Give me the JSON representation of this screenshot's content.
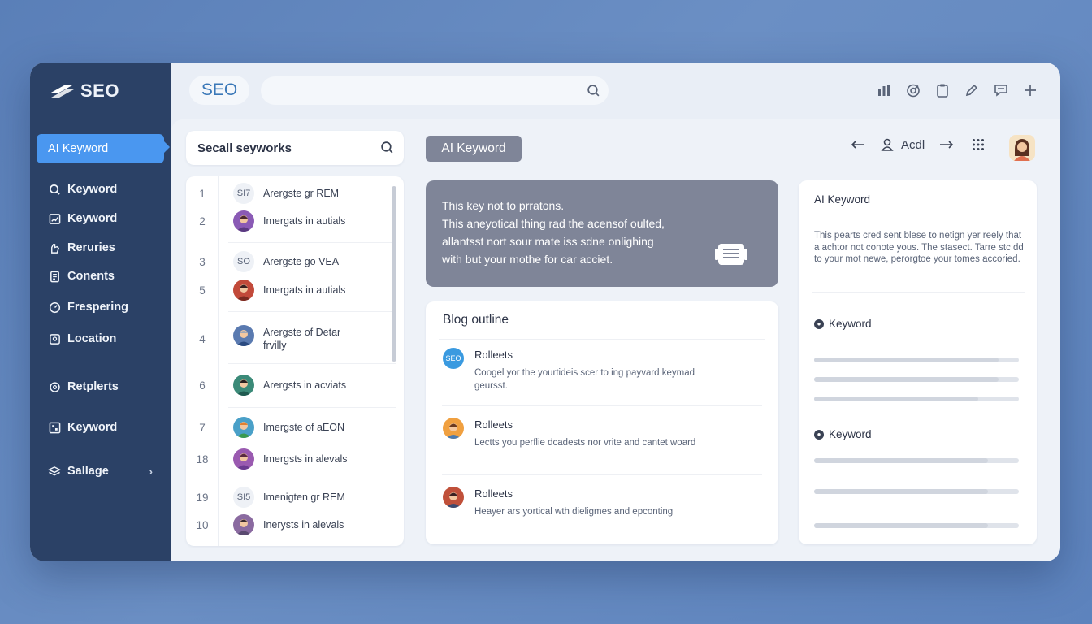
{
  "sidebar": {
    "brand": "SEO",
    "items": [
      {
        "label": "AI Keyword",
        "icon": "sparkle-icon",
        "active": true
      },
      {
        "label": "Keyword",
        "icon": "search-icon"
      },
      {
        "label": "Keyword",
        "icon": "chart-icon"
      },
      {
        "label": "Reruries",
        "icon": "hand-icon"
      },
      {
        "label": "Conents",
        "icon": "document-icon"
      },
      {
        "label": "Frespering",
        "icon": "gauge-icon"
      },
      {
        "label": "Location",
        "icon": "location-icon"
      },
      {
        "label": "Retplerts",
        "icon": "settings-icon"
      },
      {
        "label": "Keyword",
        "icon": "grid-icon"
      },
      {
        "label": "Sallage",
        "icon": "layers-icon",
        "chevron": "›"
      }
    ]
  },
  "topbar": {
    "pill": "SEO",
    "search_placeholder": "",
    "tools": [
      "bar-chart-icon",
      "target-icon",
      "clipboard-icon",
      "pencil-icon",
      "comment-icon",
      "plus-icon"
    ]
  },
  "keyword_search": {
    "label": "Secall seyworks"
  },
  "keywords": [
    {
      "num": "1",
      "avatar_text": "SI7",
      "label": "Arergste gr REM"
    },
    {
      "num": "2",
      "avatar_color": "#8a5ab5",
      "label": "Imergats in autials"
    },
    {
      "num": "3",
      "avatar_text": "SO",
      "label": "Arergste go VEA"
    },
    {
      "num": "5",
      "avatar_color": "#c24a3a",
      "label": "Imergats in autials"
    },
    {
      "num": "4",
      "avatar_color": "#5a7ab0",
      "label": "Arergste of Detar frvilly"
    },
    {
      "num": "6",
      "avatar_color": "#3b8a78",
      "label": "Arergsts in acviats"
    },
    {
      "num": "7",
      "avatar_color": "#4aa0c8",
      "label": "Imergste of aEON"
    },
    {
      "num": "18",
      "avatar_color": "#9a5ab0",
      "label": "Imergsts in alevals"
    },
    {
      "num": "19",
      "avatar_text": "SI5",
      "label": "Imenigten gr REM"
    },
    {
      "num": "10",
      "avatar_color": "#8a6aa0",
      "label": "Inerysts in alevals"
    }
  ],
  "middle": {
    "chip": "AI Keyword",
    "nav_label": "Acdl",
    "info_lines": [
      "This key not to prratons.",
      "This aneyotical thing rad the acensof oulted,",
      "allantsst nort sour mate iss sdne onlighing",
      "with but your mothe for car acciet."
    ],
    "outline": {
      "title": "Blog outline",
      "items": [
        {
          "avatar": "SEO",
          "title": "Rolleets",
          "desc": "Coogel yor the yourtideis scer to ing payvard keymad geursst."
        },
        {
          "avatar_color": "#f0a040",
          "title": "Rolleets",
          "desc": "Lectts you perflie dcadests nor vrite and cantet woard"
        },
        {
          "avatar_color": "#c0503a",
          "title": "Rolleets",
          "desc": "Heayer ars yortical wth dieligmes and epconting"
        }
      ]
    }
  },
  "right": {
    "title": "AI Keyword",
    "desc": "This pearts cred sent blese to netign yer reely that a achtor not conote yous. The stasect. Tarre stc dd to your mot newe, perorgtoe your tomes accoried.",
    "sections": [
      {
        "label": "Keyword",
        "bars": [
          0.9,
          0.9,
          0.8
        ]
      },
      {
        "label": "Keyword",
        "bars": [
          0.85,
          0.85,
          0.85
        ]
      }
    ]
  }
}
